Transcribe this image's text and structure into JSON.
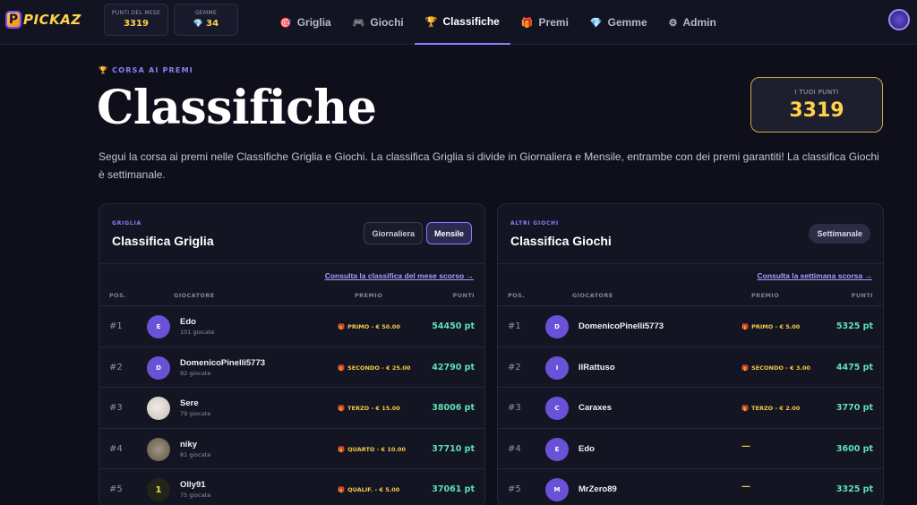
{
  "brand": {
    "logo_letter": "P",
    "logo_text": "PICKAZ"
  },
  "stats": [
    {
      "label": "PUNTI DEL MESE",
      "value": "3319"
    },
    {
      "label": "GEMME",
      "value": "34",
      "icon": "gem-icon"
    }
  ],
  "nav": [
    {
      "icon": "🎯",
      "label": "Griglia"
    },
    {
      "icon": "🎮",
      "label": "Giochi"
    },
    {
      "icon": "🏆",
      "label": "Classifiche",
      "active": true
    },
    {
      "icon": "🎁",
      "label": "Premi"
    },
    {
      "icon": "💎",
      "label": "Gemme"
    },
    {
      "icon": "⚙",
      "label": "Admin"
    }
  ],
  "hero": {
    "kicker_icon": "🏆",
    "kicker": "CORSA AI PREMI",
    "title": "Classifiche",
    "intro": "Segui la corsa ai premi nelle Classifiche Griglia e Giochi. La classifica Griglia si divide in Giornaliera e Mensile, entrambe con dei premi garantiti! La classifica Giochi è settimanale."
  },
  "points_card": {
    "label": "I TUOI PUNTI",
    "value": "3319"
  },
  "columns": {
    "pos": "POS.",
    "player": "GIOCATORE",
    "prize": "PREMIO",
    "points": "PUNTI"
  },
  "griglia": {
    "kicker": "GRIGLIA",
    "title": "Classifica Griglia",
    "tabs": [
      "Giornaliera",
      "Mensile"
    ],
    "active_tab": "Mensile",
    "link": "Consulta la classifica del mese scorso →",
    "rows": [
      {
        "pos": "#1",
        "initial": "E",
        "name": "Edo",
        "sub": "101 giocate",
        "prize": "PRIMO - € 50.00",
        "points": "54450 pt"
      },
      {
        "pos": "#2",
        "initial": "D",
        "name": "DomenicoPinelli5773",
        "sub": "92 giocate",
        "prize": "SECONDO - € 25.00",
        "points": "42790 pt"
      },
      {
        "pos": "#3",
        "initial": "",
        "name": "Sere",
        "sub": "79 giocate",
        "prize": "TERZO - € 15.00",
        "points": "38006 pt"
      },
      {
        "pos": "#4",
        "initial": "",
        "name": "niky",
        "sub": "81 giocate",
        "prize": "QUARTO - € 10.00",
        "points": "37710 pt"
      },
      {
        "pos": "#5",
        "initial": "1",
        "name": "Olly91",
        "sub": "75 giocate",
        "prize": "QUALIF. - € 5.00",
        "points": "37061 pt"
      }
    ]
  },
  "giochi": {
    "kicker": "ALTRI GIOCHI",
    "title": "Classifica Giochi",
    "tab": "Settimanale",
    "link": "Consulta la settimana scorsa →",
    "rows": [
      {
        "pos": "#1",
        "initial": "D",
        "name": "DomenicoPinelli5773",
        "prize": "PRIMO - € 5.00",
        "points": "5325 pt"
      },
      {
        "pos": "#2",
        "initial": "I",
        "name": "IlRattuso",
        "prize": "SECONDO - € 3.00",
        "points": "4475 pt"
      },
      {
        "pos": "#3",
        "initial": "C",
        "name": "Caraxes",
        "prize": "TERZO - € 2.00",
        "points": "3770 pt"
      },
      {
        "pos": "#4",
        "initial": "E",
        "name": "Edo",
        "prize": "—",
        "points": "3600 pt"
      },
      {
        "pos": "#5",
        "initial": "M",
        "name": "MrZero89",
        "prize": "—",
        "points": "3325 pt"
      }
    ]
  },
  "colors": {
    "accent": "#8b7bff",
    "gold": "#ffd24a",
    "points": "#5fe0b4",
    "bg": "#0e0f1a"
  }
}
